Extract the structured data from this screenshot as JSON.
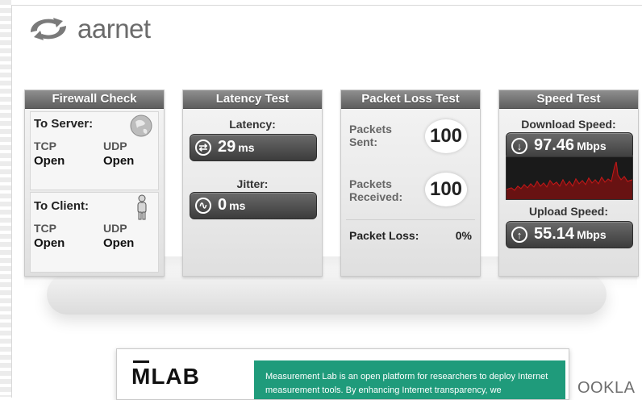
{
  "brand": {
    "name": "aarnet",
    "logo_icon": "aarnet-swirl-icon"
  },
  "firewall": {
    "title": "Firewall Check",
    "to_server": {
      "label": "To Server:",
      "tcp_label": "TCP",
      "tcp_value": "Open",
      "udp_label": "UDP",
      "udp_value": "Open",
      "icon": "globe-icon"
    },
    "to_client": {
      "label": "To Client:",
      "tcp_label": "TCP",
      "tcp_value": "Open",
      "udp_label": "UDP",
      "udp_value": "Open",
      "icon": "person-icon"
    }
  },
  "latency": {
    "title": "Latency Test",
    "latency_label": "Latency:",
    "latency_value": "29",
    "latency_unit": "ms",
    "jitter_label": "Jitter:",
    "jitter_value": "0",
    "jitter_unit": "ms"
  },
  "packet_loss": {
    "title": "Packet Loss Test",
    "sent_label": "Packets Sent:",
    "sent_value": "100",
    "received_label": "Packets Received:",
    "received_value": "100",
    "loss_label": "Packet Loss:",
    "loss_value": "0%"
  },
  "speed": {
    "title": "Speed Test",
    "download_label": "Download Speed:",
    "download_value": "97.46",
    "download_unit": "Mbps",
    "upload_label": "Upload Speed:",
    "upload_value": "55.14",
    "upload_unit": "Mbps"
  },
  "mlab": {
    "logo": "MLAB",
    "text": "Measurement Lab is an open platform for researchers to deploy Internet measurement tools. By enhancing Internet transparency, we"
  },
  "ookla": {
    "logo": "OOKLA"
  },
  "colors": {
    "accent_green": "#1f9b7b",
    "graph_red": "#d41c1c"
  }
}
